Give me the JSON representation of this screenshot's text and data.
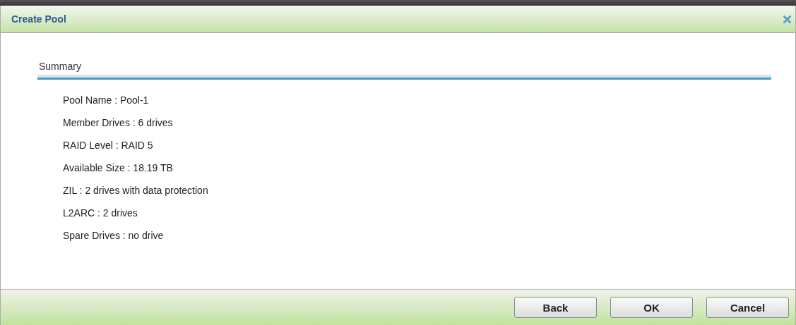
{
  "window": {
    "title": "Create Pool"
  },
  "section": {
    "title": "Summary"
  },
  "summary": [
    "Pool Name : Pool-1",
    "Member Drives : 6 drives",
    "RAID Level : RAID 5",
    "Available Size : 18.19 TB",
    "ZIL : 2 drives with data protection",
    "L2ARC : 2 drives",
    "Spare Drives : no drive"
  ],
  "buttons": [
    "Back",
    "OK",
    "Cancel"
  ]
}
